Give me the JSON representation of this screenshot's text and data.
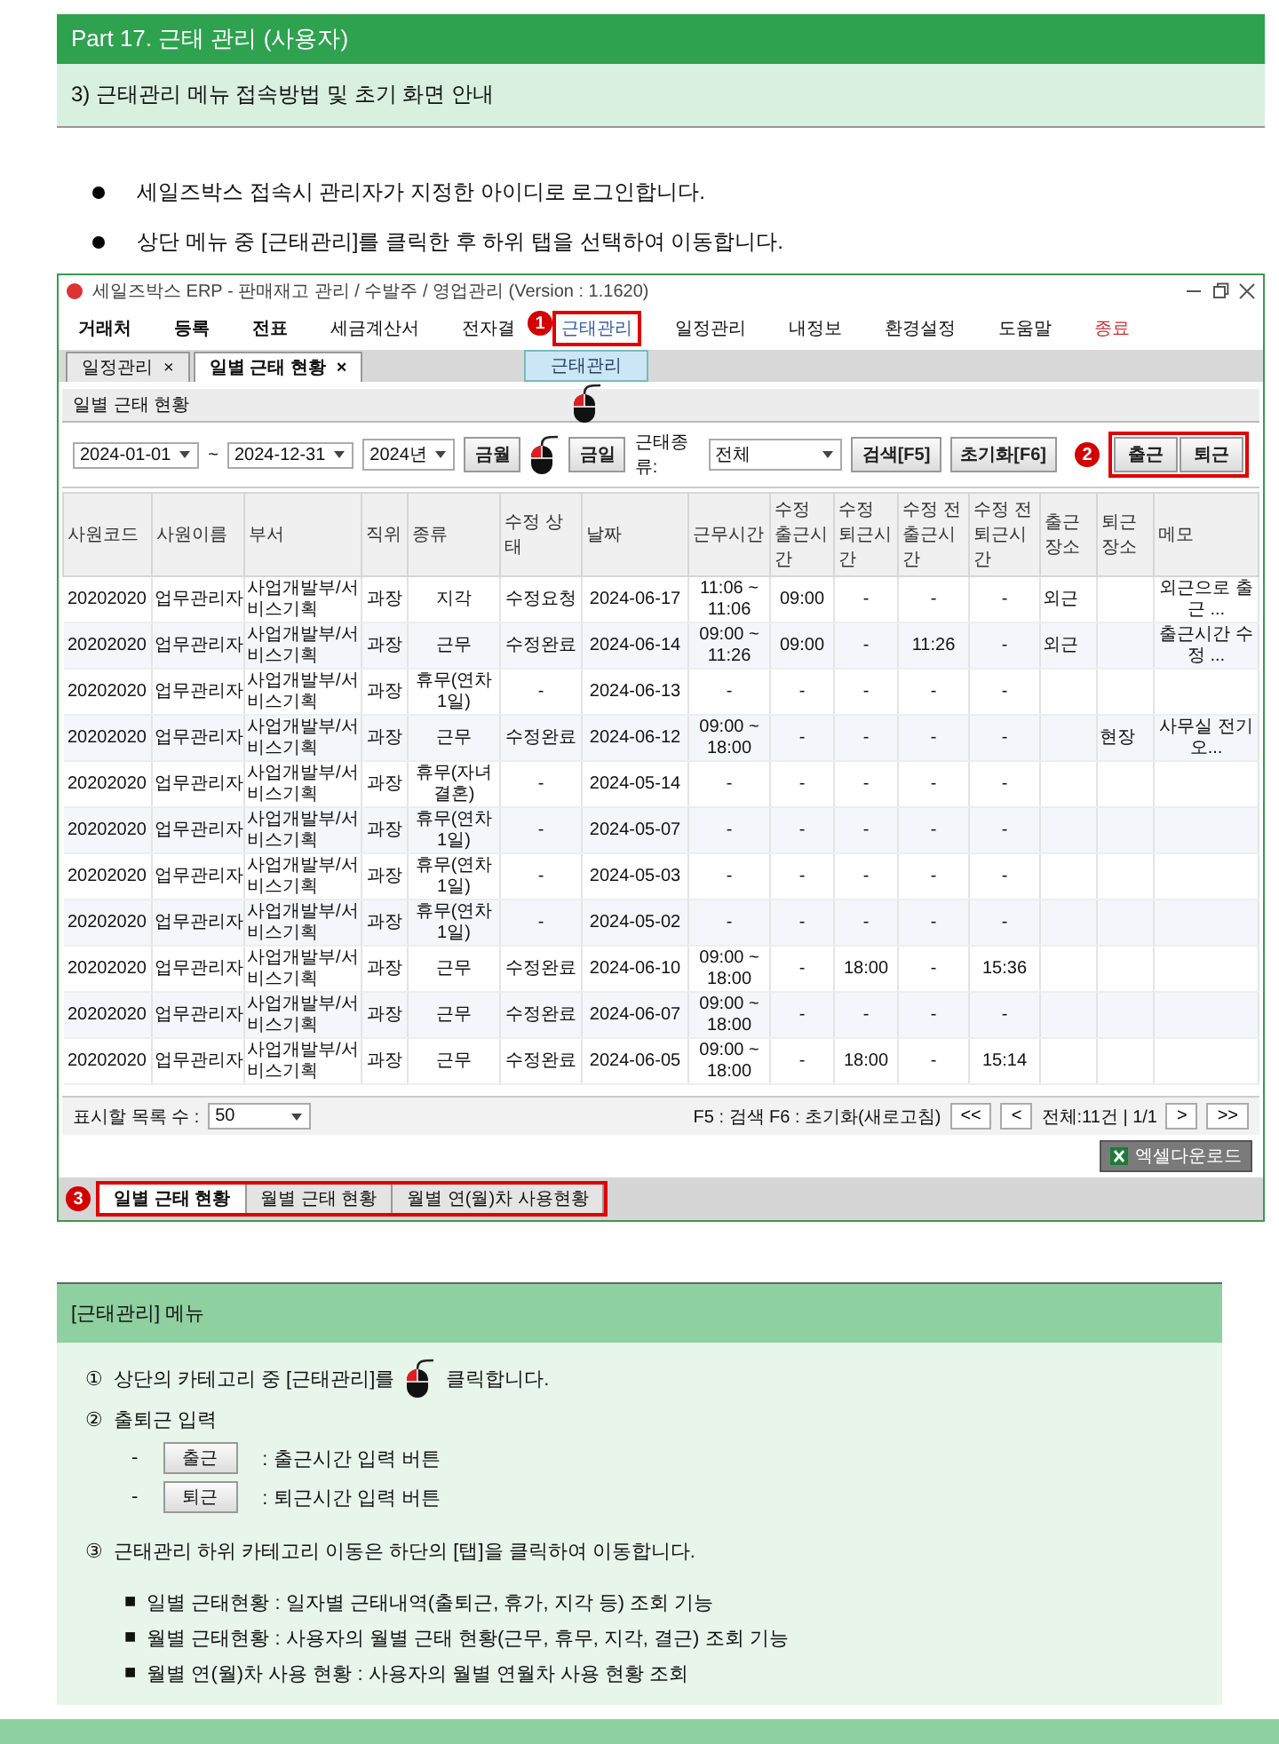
{
  "part_header": "Part 17. 근태 관리 (사용자)",
  "section_title": "3) 근태관리 메뉴 접속방법 및 초기 화면 안내",
  "bullets": [
    "세일즈박스 접속시 관리자가 지정한 아이디로 로그인합니다.",
    "상단 메뉴 중 [근태관리]를 클릭한 후 하위 탭을 선택하여 이동합니다."
  ],
  "app": {
    "title": "세일즈박스 ERP - 판매재고 관리 / 수발주 / 영업관리 (Version : 1.1620)",
    "menu": [
      {
        "label": "거래처",
        "kind": "bold",
        "selected": false
      },
      {
        "label": "등록",
        "kind": "bold",
        "selected": false
      },
      {
        "label": "전표",
        "kind": "bold",
        "selected": false
      },
      {
        "label": "세금계산서",
        "kind": "normal",
        "selected": false
      },
      {
        "label": "전자결",
        "kind": "normal",
        "selected": false
      },
      {
        "label": "근태관리",
        "kind": "normal",
        "selected": true
      },
      {
        "label": "일정관리",
        "kind": "normal",
        "selected": false
      },
      {
        "label": "내정보",
        "kind": "normal",
        "selected": false
      },
      {
        "label": "환경설정",
        "kind": "normal",
        "selected": false
      },
      {
        "label": "도움말",
        "kind": "normal",
        "selected": false
      },
      {
        "label": "종료",
        "kind": "exit",
        "selected": false
      }
    ],
    "menu_badge": "1",
    "dropdown_item": "근태관리",
    "doc_tabs": [
      {
        "label": "일정관리",
        "close": "×",
        "selected": false
      },
      {
        "label": "일별 근태 현황",
        "close": "×",
        "selected": true
      }
    ],
    "section": "일별 근태 현황",
    "filter": {
      "date_from": "2024-01-01",
      "separator": "~",
      "date_to": "2024-12-31",
      "year": "2024년",
      "month_button": "금월",
      "today_button": "금일",
      "type_label": "근태종류:",
      "type_value": "전체",
      "search_button": "검색[F5]",
      "reset_button": "초기화[F6]"
    },
    "action_badge": "2",
    "action_buttons": [
      "출근",
      "퇴근"
    ],
    "table": {
      "columns": [
        "사원코드",
        "사원이름",
        "부서",
        "직위",
        "종류",
        "수정 상태",
        "날짜",
        "근무시간",
        "수정 출근시간",
        "수정 퇴근시간",
        "수정 전 출근시간",
        "수정 전 퇴근시간",
        "출근장소",
        "퇴근장소",
        "메모"
      ],
      "rows": [
        [
          "20202020",
          "업무관리자",
          "사업개발부/서비스기획",
          "과장",
          "지각",
          "수정요청",
          "2024-06-17",
          "11:06 ~ 11:06",
          "09:00",
          "-",
          "-",
          "-",
          "외근",
          null,
          "외근으로 출근 ..."
        ],
        [
          "20202020",
          "업무관리자",
          "사업개발부/서비스기획",
          "과장",
          "근무",
          "수정완료",
          "2024-06-14",
          "09:00 ~ 11:26",
          "09:00",
          "-",
          "11:26",
          "-",
          "외근",
          null,
          "출근시간 수정 ..."
        ],
        [
          "20202020",
          "업무관리자",
          "사업개발부/서비스기획",
          "과장",
          "휴무(연차 1일)",
          "-",
          "2024-06-13",
          "-",
          "-",
          "-",
          "-",
          "-",
          null,
          null,
          null
        ],
        [
          "20202020",
          "업무관리자",
          "사업개발부/서비스기획",
          "과장",
          "근무",
          "수정완료",
          "2024-06-12",
          "09:00 ~ 18:00",
          "-",
          "-",
          "-",
          "-",
          null,
          "현장",
          "사무실 전기 오..."
        ],
        [
          "20202020",
          "업무관리자",
          "사업개발부/서비스기획",
          "과장",
          "휴무(자녀결혼)",
          "-",
          "2024-05-14",
          "-",
          "-",
          "-",
          "-",
          "-",
          null,
          null,
          null
        ],
        [
          "20202020",
          "업무관리자",
          "사업개발부/서비스기획",
          "과장",
          "휴무(연차 1일)",
          "-",
          "2024-05-07",
          "-",
          "-",
          "-",
          "-",
          "-",
          null,
          null,
          null
        ],
        [
          "20202020",
          "업무관리자",
          "사업개발부/서비스기획",
          "과장",
          "휴무(연차 1일)",
          "-",
          "2024-05-03",
          "-",
          "-",
          "-",
          "-",
          "-",
          null,
          null,
          null
        ],
        [
          "20202020",
          "업무관리자",
          "사업개발부/서비스기획",
          "과장",
          "휴무(연차 1일)",
          "-",
          "2024-05-02",
          "-",
          "-",
          "-",
          "-",
          "-",
          null,
          null,
          null
        ],
        [
          "20202020",
          "업무관리자",
          "사업개발부/서비스기획",
          "과장",
          "근무",
          "수정완료",
          "2024-06-10",
          "09:00 ~ 18:00",
          "-",
          "18:00",
          "-",
          "15:36",
          null,
          null,
          null
        ],
        [
          "20202020",
          "업무관리자",
          "사업개발부/서비스기획",
          "과장",
          "근무",
          "수정완료",
          "2024-06-07",
          "09:00 ~ 18:00",
          "-",
          "-",
          "-",
          "-",
          null,
          null,
          null
        ],
        [
          "20202020",
          "업무관리자",
          "사업개발부/서비스기획",
          "과장",
          "근무",
          "수정완료",
          "2024-06-05",
          "09:00 ~ 18:00",
          "-",
          "18:00",
          "-",
          "15:14",
          null,
          null,
          null
        ]
      ]
    },
    "footer": {
      "page_size_label": "표시할 목록 수 :",
      "page_size": "50",
      "hint": "F5 : 검색  F6 : 초기화(새로고침)",
      "first": "<<",
      "prev": "<",
      "summary": "전체:11건 | 1/1",
      "next": ">",
      "last": ">>"
    },
    "excel_button": "엑셀다운로드",
    "tab_badge": "3",
    "bottom_tabs": [
      {
        "label": "일별 근태 현황",
        "selected": true
      },
      {
        "label": "월별 근태 현황",
        "selected": false
      },
      {
        "label": "월별 연(월)차 사용현황",
        "selected": false
      }
    ]
  },
  "panel": {
    "title": "[근태관리] 메뉴",
    "step1": {
      "mark": "①",
      "before": "상단의 카테고리 중 [근태관리]를",
      "after": "클릭합니다."
    },
    "step2": {
      "mark": "②",
      "text": "출퇴근 입력",
      "items": [
        {
          "dash": "-",
          "button": "출근",
          "desc": ": 출근시간 입력 버튼"
        },
        {
          "dash": "-",
          "button": "퇴근",
          "desc": ": 퇴근시간 입력 버튼"
        }
      ]
    },
    "step3": {
      "mark": "③",
      "text": "근태관리 하위 카테고리 이동은 하단의 [탭]을 클릭하여 이동합니다.",
      "items": [
        {
          "mark": "■",
          "text": "일별 근태현황 : 일자별 근태내역(출퇴근, 휴가, 지각 등) 조회 기능"
        },
        {
          "mark": "■",
          "text": "월별 근태현황 : 사용자의 월별 근태 현황(근무, 휴무, 지각, 결근) 조회 기능"
        },
        {
          "mark": "■",
          "text": "월별 연(월)차 사용 현황 : 사용자의 월별 연월차 사용 현황 조회"
        }
      ]
    }
  }
}
